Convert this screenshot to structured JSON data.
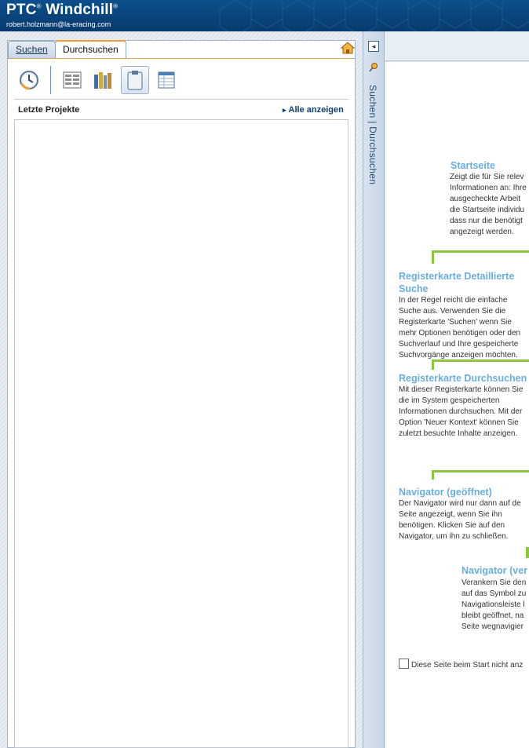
{
  "header": {
    "brand": "PTC",
    "brand_mark": "®",
    "product": "Windchill",
    "product_mark": "®",
    "user_email": "robert.holzmann@la-eracing.com"
  },
  "tabs": [
    {
      "label": "Suchen",
      "active": false
    },
    {
      "label": "Durchsuchen",
      "active": true
    }
  ],
  "toolbar": {
    "buttons": [
      {
        "icon": "recent-history-icon"
      },
      {
        "icon": "product-list-icon"
      },
      {
        "icon": "library-books-icon"
      },
      {
        "icon": "project-clipboard-icon",
        "active": true
      },
      {
        "icon": "table-view-icon"
      }
    ]
  },
  "recent": {
    "title": "Letzte Projekte",
    "show_all": "Alle anzeigen"
  },
  "strip": {
    "label": "Suchen | Durchsuchen",
    "collapse_glyph": "◂"
  },
  "help": {
    "startseite": {
      "title": "Startseite",
      "lines": [
        "Zeigt die für Sie relev",
        "Informationen an: Ihre",
        "ausgecheckte Arbeit",
        "die Startseite individu",
        "dass nur die benötigt",
        "angezeigt werden."
      ]
    },
    "detail": {
      "title_line1": "Registerkarte Detaillierte",
      "title_line2": "Suche",
      "lines": [
        "In der Regel reicht die einfache",
        "Suche aus. Verwenden Sie die",
        "Registerkarte 'Suchen' wenn Sie",
        "mehr Optionen benötigen oder den",
        "Suchverlauf und Ihre gespeicherte",
        "Suchvorgänge anzeigen möchten."
      ]
    },
    "durchsuchen": {
      "title": "Registerkarte Durchsuchen",
      "lines": [
        "Mit dieser Registerkarte können Sie",
        "die im System gespeicherten",
        "Informationen durchsuchen. Mit der",
        "Option 'Neuer Kontext' können Sie",
        "zuletzt besuchte Inhalte anzeigen."
      ]
    },
    "navigator_open": {
      "title": "Navigator (geöffnet)",
      "lines": [
        "Der Navigator wird nur dann auf de",
        "Seite angezeigt, wenn Sie ihn",
        "benötigen. Klicken Sie auf den",
        "Navigator, um ihn zu schließen."
      ]
    },
    "navigator_anchored": {
      "title": "Navigator (ver",
      "lines": [
        "Verankern Sie den",
        "auf das Symbol zu",
        "Navigationsleiste l",
        "bleibt geöffnet, na",
        "Seite wegnavigier"
      ]
    },
    "dont_show": "Diese Seite beim Start nicht anz"
  },
  "colors": {
    "header_bg": "#0b4f8c",
    "help_title": "#6aaee0",
    "connector_green": "#8cc63f",
    "active_tab_accent": "#f0a030"
  }
}
